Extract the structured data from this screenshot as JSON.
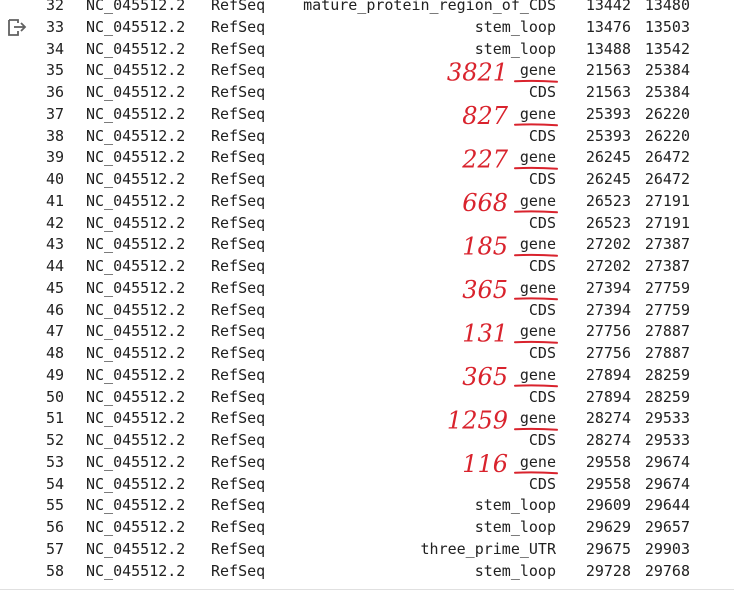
{
  "rows": [
    {
      "idx": "32",
      "seqid": "NC_045512.2",
      "source": "RefSeq",
      "type": "mature_protein_region_of_CDS",
      "start": "13442",
      "end": "13480"
    },
    {
      "idx": "33",
      "seqid": "NC_045512.2",
      "source": "RefSeq",
      "type": "stem_loop",
      "start": "13476",
      "end": "13503"
    },
    {
      "idx": "34",
      "seqid": "NC_045512.2",
      "source": "RefSeq",
      "type": "stem_loop",
      "start": "13488",
      "end": "13542"
    },
    {
      "idx": "35",
      "seqid": "NC_045512.2",
      "source": "RefSeq",
      "type": "gene",
      "start": "21563",
      "end": "25384"
    },
    {
      "idx": "36",
      "seqid": "NC_045512.2",
      "source": "RefSeq",
      "type": "CDS",
      "start": "21563",
      "end": "25384"
    },
    {
      "idx": "37",
      "seqid": "NC_045512.2",
      "source": "RefSeq",
      "type": "gene",
      "start": "25393",
      "end": "26220"
    },
    {
      "idx": "38",
      "seqid": "NC_045512.2",
      "source": "RefSeq",
      "type": "CDS",
      "start": "25393",
      "end": "26220"
    },
    {
      "idx": "39",
      "seqid": "NC_045512.2",
      "source": "RefSeq",
      "type": "gene",
      "start": "26245",
      "end": "26472"
    },
    {
      "idx": "40",
      "seqid": "NC_045512.2",
      "source": "RefSeq",
      "type": "CDS",
      "start": "26245",
      "end": "26472"
    },
    {
      "idx": "41",
      "seqid": "NC_045512.2",
      "source": "RefSeq",
      "type": "gene",
      "start": "26523",
      "end": "27191"
    },
    {
      "idx": "42",
      "seqid": "NC_045512.2",
      "source": "RefSeq",
      "type": "CDS",
      "start": "26523",
      "end": "27191"
    },
    {
      "idx": "43",
      "seqid": "NC_045512.2",
      "source": "RefSeq",
      "type": "gene",
      "start": "27202",
      "end": "27387"
    },
    {
      "idx": "44",
      "seqid": "NC_045512.2",
      "source": "RefSeq",
      "type": "CDS",
      "start": "27202",
      "end": "27387"
    },
    {
      "idx": "45",
      "seqid": "NC_045512.2",
      "source": "RefSeq",
      "type": "gene",
      "start": "27394",
      "end": "27759"
    },
    {
      "idx": "46",
      "seqid": "NC_045512.2",
      "source": "RefSeq",
      "type": "CDS",
      "start": "27394",
      "end": "27759"
    },
    {
      "idx": "47",
      "seqid": "NC_045512.2",
      "source": "RefSeq",
      "type": "gene",
      "start": "27756",
      "end": "27887"
    },
    {
      "idx": "48",
      "seqid": "NC_045512.2",
      "source": "RefSeq",
      "type": "CDS",
      "start": "27756",
      "end": "27887"
    },
    {
      "idx": "49",
      "seqid": "NC_045512.2",
      "source": "RefSeq",
      "type": "gene",
      "start": "27894",
      "end": "28259"
    },
    {
      "idx": "50",
      "seqid": "NC_045512.2",
      "source": "RefSeq",
      "type": "CDS",
      "start": "27894",
      "end": "28259"
    },
    {
      "idx": "51",
      "seqid": "NC_045512.2",
      "source": "RefSeq",
      "type": "gene",
      "start": "28274",
      "end": "29533"
    },
    {
      "idx": "52",
      "seqid": "NC_045512.2",
      "source": "RefSeq",
      "type": "CDS",
      "start": "28274",
      "end": "29533"
    },
    {
      "idx": "53",
      "seqid": "NC_045512.2",
      "source": "RefSeq",
      "type": "gene",
      "start": "29558",
      "end": "29674"
    },
    {
      "idx": "54",
      "seqid": "NC_045512.2",
      "source": "RefSeq",
      "type": "CDS",
      "start": "29558",
      "end": "29674"
    },
    {
      "idx": "55",
      "seqid": "NC_045512.2",
      "source": "RefSeq",
      "type": "stem_loop",
      "start": "29609",
      "end": "29644"
    },
    {
      "idx": "56",
      "seqid": "NC_045512.2",
      "source": "RefSeq",
      "type": "stem_loop",
      "start": "29629",
      "end": "29657"
    },
    {
      "idx": "57",
      "seqid": "NC_045512.2",
      "source": "RefSeq",
      "type": "three_prime_UTR",
      "start": "29675",
      "end": "29903"
    },
    {
      "idx": "58",
      "seqid": "NC_045512.2",
      "source": "RefSeq",
      "type": "stem_loop",
      "start": "29728",
      "end": "29768"
    }
  ],
  "annotations": [
    {
      "row": "35",
      "text": "3821"
    },
    {
      "row": "37",
      "text": "827"
    },
    {
      "row": "39",
      "text": "227"
    },
    {
      "row": "41",
      "text": "668"
    },
    {
      "row": "43",
      "text": "185"
    },
    {
      "row": "45",
      "text": "365"
    },
    {
      "row": "47",
      "text": "131"
    },
    {
      "row": "49",
      "text": "365"
    },
    {
      "row": "51",
      "text": "1259"
    },
    {
      "row": "53",
      "text": "116"
    }
  ],
  "icons": {
    "output": "output-redirect-icon"
  },
  "colors": {
    "text": "#212121",
    "ink": "#d9232d",
    "icon": "#616161"
  }
}
